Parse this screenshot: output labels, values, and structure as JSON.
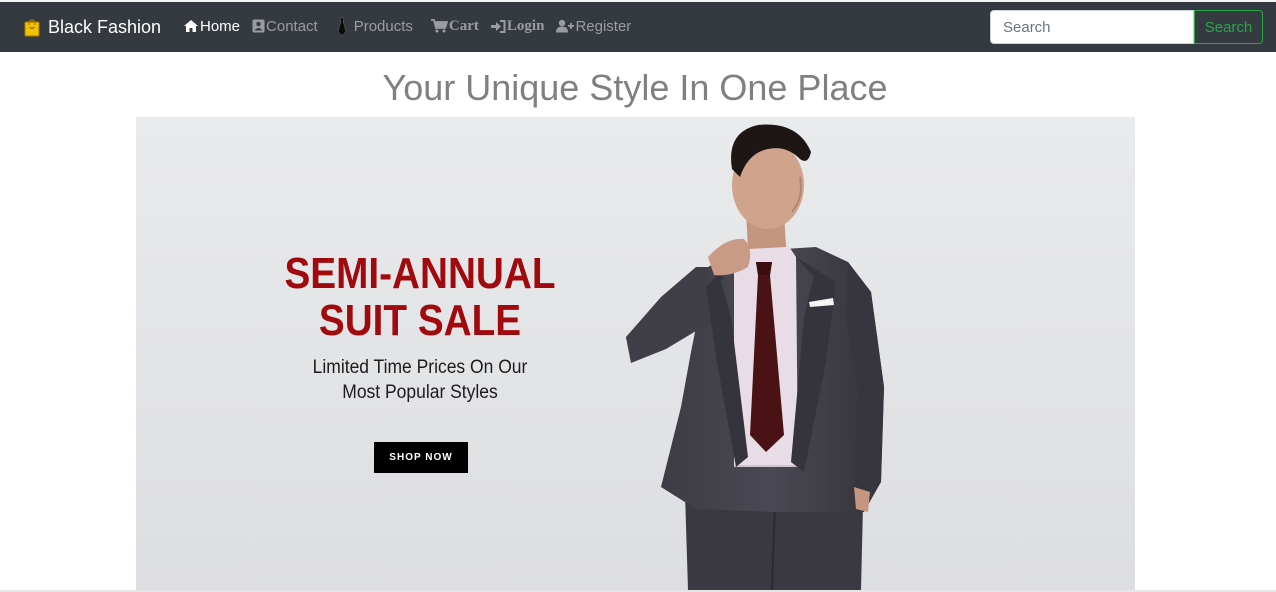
{
  "navbar": {
    "brand": "Black Fashion",
    "brand_icon": "shopping-bag-icon",
    "links": [
      {
        "label": "Home",
        "icon": "home-icon",
        "active": true
      },
      {
        "label": "Contact",
        "icon": "contact-card-icon",
        "active": false
      },
      {
        "label": "Products",
        "icon": "tie-icon",
        "active": false
      },
      {
        "label": "Cart",
        "icon": "cart-icon",
        "active": false
      },
      {
        "label": "Login",
        "icon": "sign-in-icon",
        "active": false
      },
      {
        "label": "Register",
        "icon": "user-plus-icon",
        "active": false
      }
    ],
    "search": {
      "placeholder": "Search",
      "button_label": "Search"
    }
  },
  "main": {
    "title": "Your Unique Style In One Place",
    "banner": {
      "headline_line1": "SEMI-ANNUAL",
      "headline_line2": "SUIT SALE",
      "subtext_line1": "Limited Time Prices On Our",
      "subtext_line2": "Most Popular Styles",
      "button_label": "SHOP NOW",
      "image": "man-in-suit-photo"
    }
  },
  "colors": {
    "navbar_bg": "#343a40",
    "search_accent": "#28a745",
    "headline_red": "#a00a0e",
    "title_gray": "#808080"
  }
}
